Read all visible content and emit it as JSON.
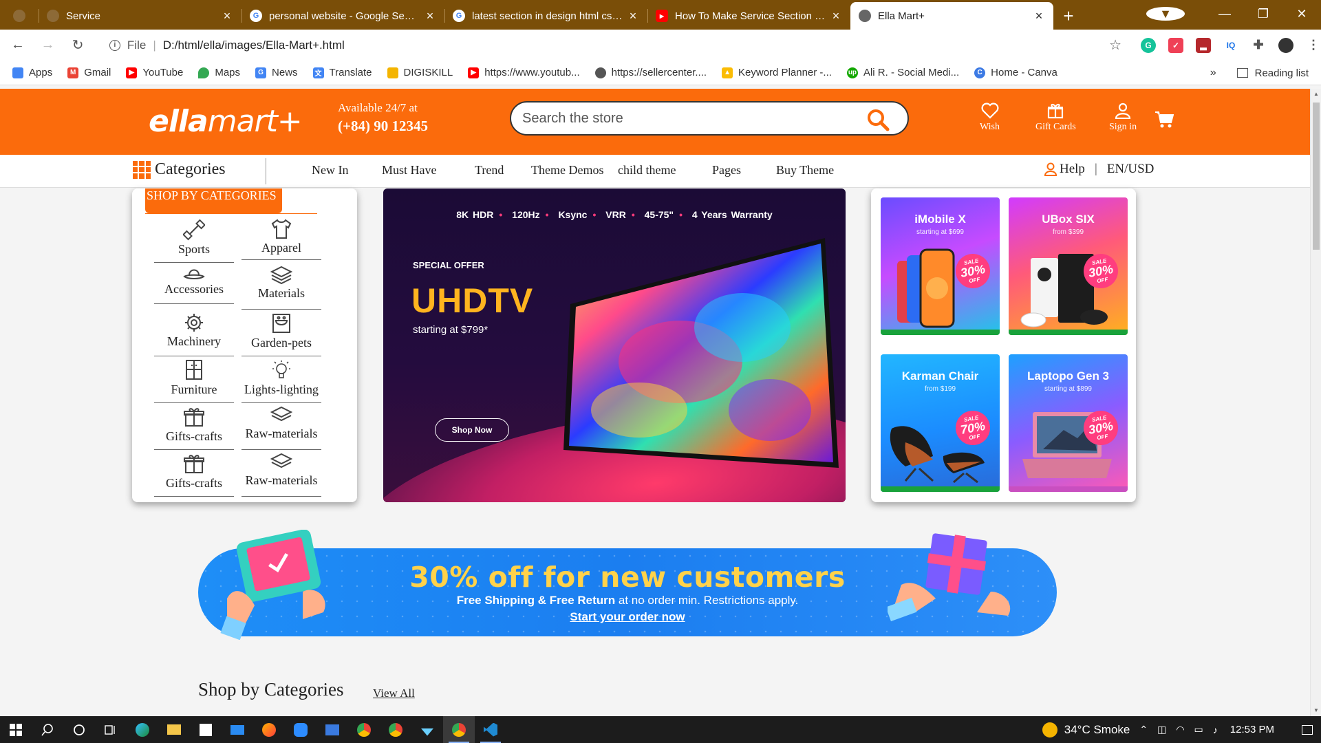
{
  "browser": {
    "tabs": [
      {
        "label": "Service",
        "active": false
      },
      {
        "label": "personal website - Google Search",
        "active": false
      },
      {
        "label": "latest section in design html css -",
        "active": false
      },
      {
        "label": "How To Make Service Section For",
        "active": false
      },
      {
        "label": "Ella Mart+",
        "active": true
      }
    ],
    "new_tab": "+",
    "address": {
      "scheme_label": "File",
      "url": "D:/html/ella/images/Ella-Mart+.html"
    },
    "bookmarks": [
      {
        "label": "Apps",
        "color": "#4285f4"
      },
      {
        "label": "Gmail",
        "color": "#ea4335"
      },
      {
        "label": "YouTube",
        "color": "#ff0000"
      },
      {
        "label": "Maps",
        "color": "#34a853"
      },
      {
        "label": "News",
        "color": "#4285f4"
      },
      {
        "label": "Translate",
        "color": "#4285f4"
      },
      {
        "label": "DIGISKILL",
        "color": "#f4b400"
      },
      {
        "label": "https://www.youtub...",
        "color": "#ff0000"
      },
      {
        "label": "https://sellercenter....",
        "color": "#555555"
      },
      {
        "label": "Keyword Planner -...",
        "color": "#fbbc04"
      },
      {
        "label": "Ali R. - Social Medi...",
        "color": "#14a800"
      },
      {
        "label": "Home - Canva",
        "color": "#3c7ae4"
      }
    ],
    "more_bookmarks": "»",
    "reading_list": "Reading list"
  },
  "site": {
    "logo_bold": "ella",
    "logo_light": "mart+",
    "contact_line1": "Available 24/7 at",
    "contact_line2": "(+84) 90 12345",
    "search_placeholder": "Search the store",
    "header_icons": [
      {
        "label": "Wish",
        "icon": "heart-icon"
      },
      {
        "label": "Gift Cards",
        "icon": "gift-icon"
      },
      {
        "label": "Sign in",
        "icon": "user-icon"
      }
    ],
    "accent_color": "#fb6b0c"
  },
  "catnav": {
    "categories_label": "Categories",
    "links": [
      "New In",
      "Must Have",
      "Trend",
      "Theme Demos",
      "child theme",
      "Pages",
      "Buy Theme"
    ],
    "help": "Help",
    "locale": "EN/USD"
  },
  "shop_panel": {
    "title": "SHOP BY CATEGORIES",
    "items": [
      {
        "label": "Sports",
        "icon": "dumbbell-icon"
      },
      {
        "label": "Apparel",
        "icon": "tshirt-icon"
      },
      {
        "label": "Accessories",
        "icon": "hat-icon"
      },
      {
        "label": "Materials",
        "icon": "layers-icon"
      },
      {
        "label": "Machinery",
        "icon": "gear-icon"
      },
      {
        "label": "Garden-pets",
        "icon": "pet-bowl-icon"
      },
      {
        "label": "Furniture",
        "icon": "cabinet-icon"
      },
      {
        "label": "Lights-lighting",
        "icon": "lightbulb-icon"
      },
      {
        "label": "Gifts-crafts",
        "icon": "gift-icon"
      },
      {
        "label": "Raw-materials",
        "icon": "layers-icon"
      },
      {
        "label": "Gifts-crafts",
        "icon": "gift-icon"
      },
      {
        "label": "Raw-materials",
        "icon": "layers-icon"
      }
    ]
  },
  "hero": {
    "specs": [
      "8K HDR",
      "120Hz",
      "Ksync",
      "VRR",
      "45-75\"",
      "4 Years Warranty"
    ],
    "offer": "SPECIAL OFFER",
    "title": "UHDTV",
    "price": "starting at $799*",
    "button": "Shop Now"
  },
  "promos": [
    {
      "name": "iMobile X",
      "sub": "starting at $699",
      "sale_label": "SALE",
      "sale_value": "30%",
      "sale_suffix": "OFF"
    },
    {
      "name": "UBox SIX",
      "sub": "from $399",
      "sale_label": "SALE",
      "sale_value": "30%",
      "sale_suffix": "OFF"
    },
    {
      "name": "Karman Chair",
      "sub": "from $199",
      "sale_label": "SALE",
      "sale_value": "70%",
      "sale_suffix": "OFF"
    },
    {
      "name": "Laptopo Gen 3",
      "sub": "starting at $899",
      "sale_label": "SALE",
      "sale_value": "30%",
      "sale_suffix": "OFF"
    }
  ],
  "banner": {
    "headline": "30% off for new customers",
    "sub_bold": "Free Shipping & Free Return",
    "sub_rest": " at no order min. Restrictions apply.",
    "cta": "Start your order now"
  },
  "section": {
    "title": "Shop by Categories",
    "view_all": "View All"
  },
  "taskbar": {
    "weather": "34°C  Smoke",
    "time": "12:53 PM"
  }
}
